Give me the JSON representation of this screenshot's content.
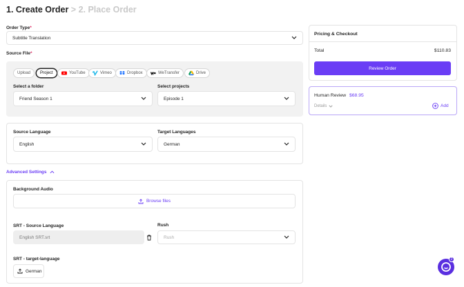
{
  "header": {
    "step1": "1. Create Order",
    "step2": " > 2. Place Order"
  },
  "order_type": {
    "label": "Order Type",
    "required_mark": "*",
    "value": "Subtitle Translation"
  },
  "source_file": {
    "label": "Source File",
    "required_mark": "*",
    "tabs": [
      {
        "label": "Upload",
        "icon": "upload-tab"
      },
      {
        "label": "Project",
        "icon": "project-tab"
      },
      {
        "label": "YouTube",
        "icon": "youtube-icon"
      },
      {
        "label": "Vimeo",
        "icon": "vimeo-icon"
      },
      {
        "label": "Dropbox",
        "icon": "dropbox-icon"
      },
      {
        "label": "WeTransfer",
        "icon": "wetransfer-icon"
      },
      {
        "label": "Drive",
        "icon": "google-drive-icon"
      }
    ],
    "folder_label": "Select a folder",
    "folder_value": "Friend Season 1",
    "projects_label": "Select projects",
    "projects_value": "Episode 1"
  },
  "languages": {
    "source_label": "Source Language",
    "source_value": "English",
    "target_label": "Target Languages",
    "target_value": "German"
  },
  "advanced": {
    "toggle_label": "Advanced Settings",
    "background_audio_label": "Background Audio",
    "browse_label": "Browse files",
    "srt_source_label": "SRT - Source Language",
    "srt_source_value": "English SRT.srt",
    "rush_label": "Rush",
    "rush_placeholder": "Rush",
    "srt_target_label": "SRT - target-language",
    "srt_target_button": "German"
  },
  "checkout": {
    "title": "Pricing & Checkout",
    "total_label": "Total",
    "total_value": "$110.83",
    "review_button": "Review Order"
  },
  "human_review": {
    "title": "Human Review",
    "price": "$68.95",
    "details_label": "Details",
    "add_label": "Add"
  },
  "chat_widget": {
    "badge": "2"
  },
  "colors": {
    "accent": "#6a3df5",
    "required": "#e0245e",
    "youtube": "#ff0000",
    "vimeo": "#1ab7ea",
    "dropbox": "#0061ff"
  }
}
